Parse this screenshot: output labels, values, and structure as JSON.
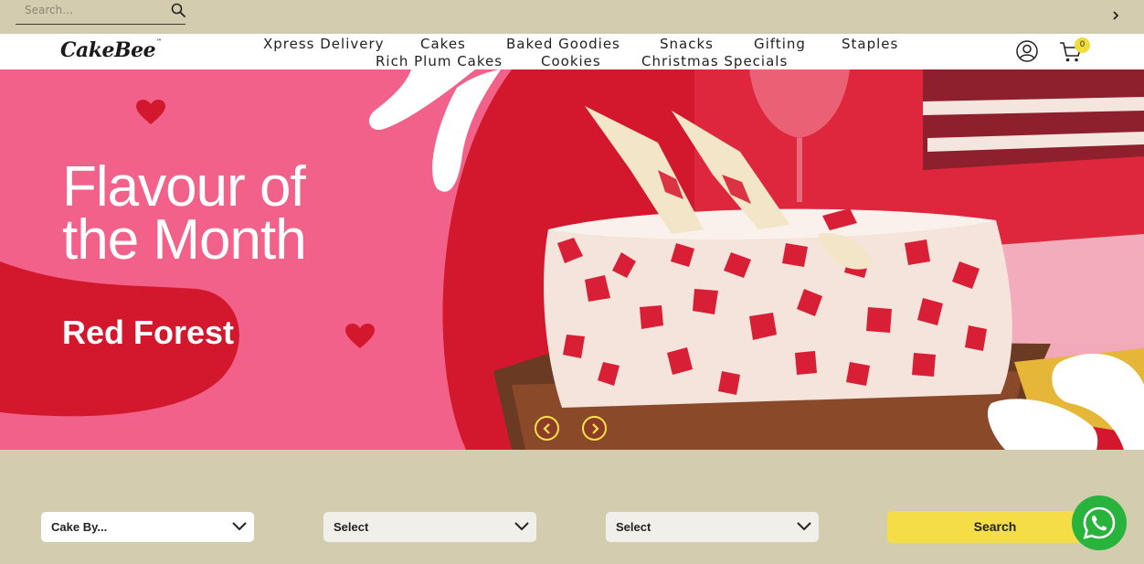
{
  "search": {
    "placeholder": "Search...",
    "value": ""
  },
  "brand": {
    "logo_text": "CakeBee",
    "tm": "™"
  },
  "nav": {
    "row1": [
      "Xpress Delivery",
      "Cakes",
      "Baked Goodies",
      "Snacks",
      "Gifting",
      "Staples"
    ],
    "row2": [
      "Rich Plum Cakes",
      "Cookies",
      "Christmas Specials"
    ]
  },
  "cart": {
    "count": "0"
  },
  "hero": {
    "title": "Flavour of the Month",
    "subtitle": "Red Forest"
  },
  "filters": {
    "select1": "Cake By...",
    "select2": "Select",
    "select3": "Select",
    "search_label": "Search"
  },
  "icons": {
    "search": "search-icon",
    "chevron": "chevron-right-icon",
    "user": "user-icon",
    "cart": "cart-icon",
    "whatsapp": "whatsapp-icon"
  },
  "colors": {
    "background": "#d4ccae",
    "accent_yellow": "#f4dd47",
    "hero_pink": "#f26189",
    "hero_red": "#d3182e",
    "whatsapp": "#27b33c"
  }
}
